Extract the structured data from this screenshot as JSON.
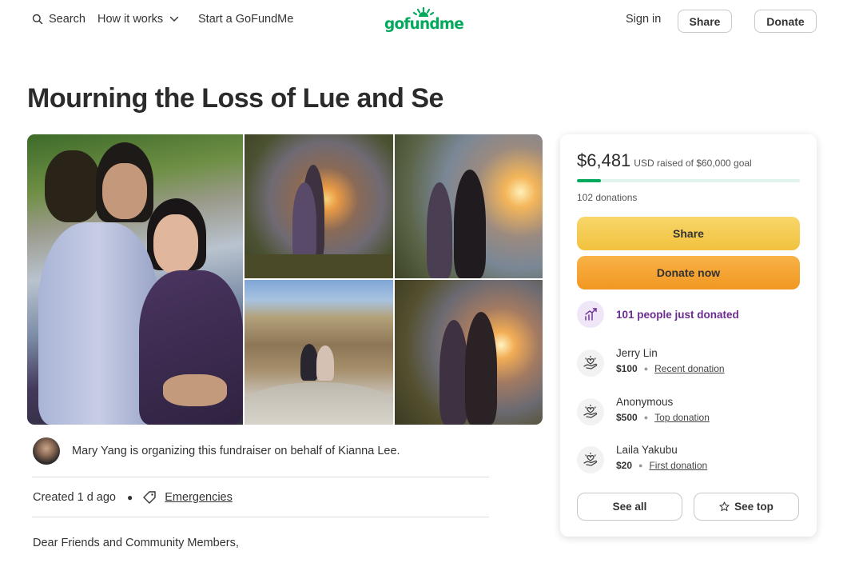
{
  "nav": {
    "search_label": "Search",
    "how_label": "How it works",
    "start_label": "Start a GoFundMe",
    "logo_text": "gofundme",
    "signin_label": "Sign in",
    "share_label": "Share",
    "donate_label": "Donate",
    "brand_color": "#02a95c"
  },
  "campaign": {
    "title": "Mourning the Loss of Lue and Se",
    "organizer_text": "Mary Yang is organizing this fundraiser on behalf of Kianna Lee.",
    "created": "Created 1 d ago",
    "category": "Emergencies",
    "body_first_line": "Dear Friends and Community Members,"
  },
  "card": {
    "raised_amount": "$6,481",
    "raised_goal_text": "USD raised of $60,000 goal",
    "progress_fraction": 0.108,
    "donation_count": "102 donations",
    "share_label": "Share",
    "donate_label": "Donate now",
    "trend_text": "101 people just donated",
    "donors": [
      {
        "name": "Jerry Lin",
        "amount": "$100",
        "label": "Recent donation"
      },
      {
        "name": "Anonymous",
        "amount": "$500",
        "label": "Top donation"
      },
      {
        "name": "Laila Yakubu",
        "amount": "$20",
        "label": "First donation"
      }
    ],
    "see_all_label": "See all",
    "see_top_label": "See top"
  },
  "icons": {
    "search": "search-icon",
    "chevron": "chevron-down-icon",
    "tag": "tag-icon",
    "trend": "trending-up-icon",
    "donor": "heart-hand-icon",
    "star": "star-icon"
  }
}
